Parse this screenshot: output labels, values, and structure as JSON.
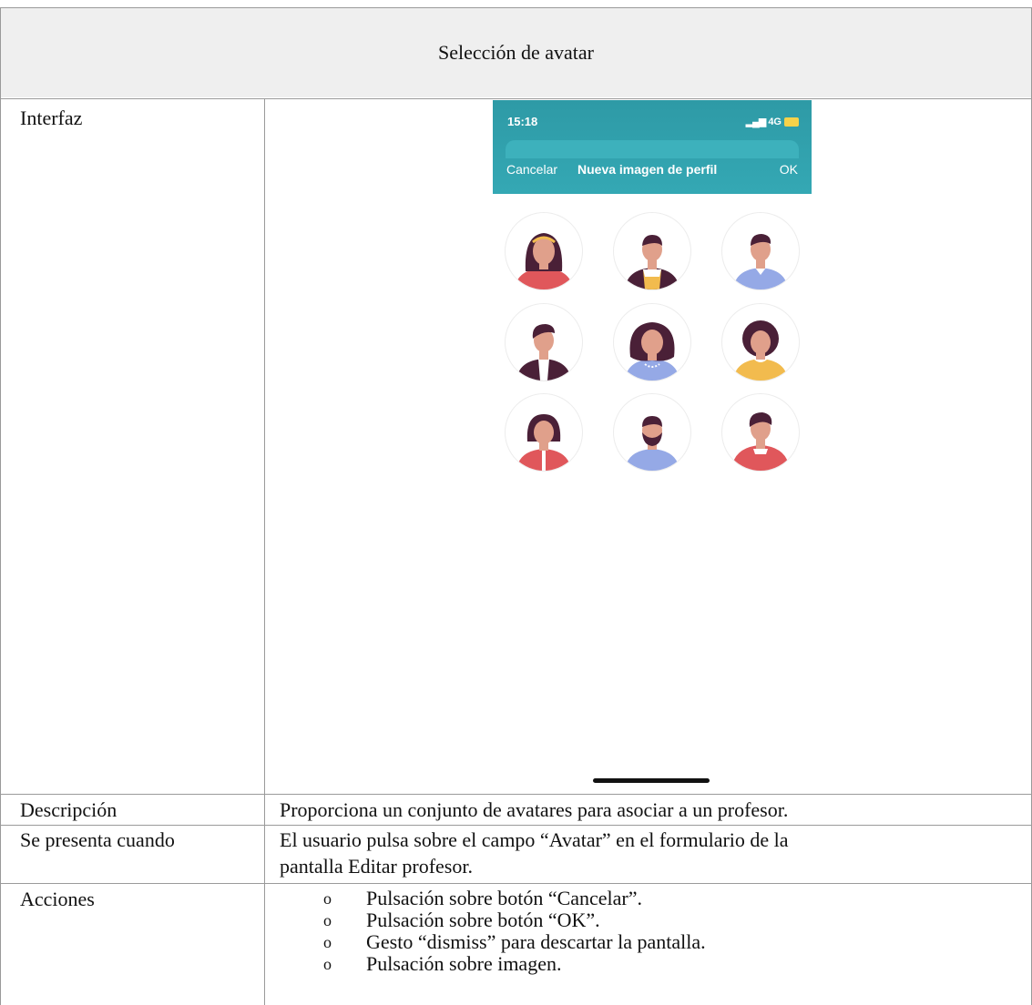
{
  "table": {
    "title": "Selección de avatar",
    "rows": {
      "interfaz_label": "Interfaz",
      "descripcion_label": "Descripción",
      "descripcion_value": "Proporciona un conjunto de avatares para asociar a un profesor.",
      "se_presenta_label": "Se presenta cuando",
      "se_presenta_line1": "El usuario pulsa sobre el campo “Avatar” en el formulario de la",
      "se_presenta_line2": "pantalla Editar profesor.",
      "acciones_label": "Acciones",
      "acciones": [
        "Pulsación sobre botón “Cancelar”.",
        "Pulsación sobre botón “OK”.",
        "Gesto “dismiss” para descartar la pantalla.",
        "Pulsación sobre imagen."
      ]
    }
  },
  "phone": {
    "status_time": "15:18",
    "status_network": "4G",
    "nav_cancel": "Cancelar",
    "nav_title": "Nueva imagen de perfil",
    "nav_ok": "OK",
    "colors": {
      "header": "#32a3af",
      "skin": "#e0a08b",
      "hair": "#4a2037",
      "red": "#e0575b",
      "blue": "#95a9e6",
      "yellow": "#f2bb4e"
    }
  }
}
